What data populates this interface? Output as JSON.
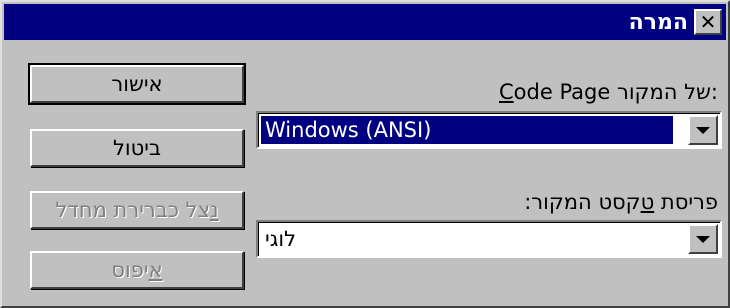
{
  "dialog": {
    "title": "המרה",
    "close_symbol": "✕"
  },
  "buttons": {
    "ok": "אישור",
    "cancel": "ביטול",
    "show_preview_prefix": "",
    "show_preview_underline": "נ",
    "show_preview_rest": "צל כברירת מחדל",
    "reset_underline": "א",
    "reset_rest": "יפוס"
  },
  "code_page": {
    "label_prefix": "",
    "label_underline": "C",
    "label_rest": "ode Page של המקור:",
    "value": "Windows (ANSI)"
  },
  "text_layout": {
    "label_before": "פריסת ",
    "label_underline": "ט",
    "label_rest": "קסט המקור:",
    "value": "לוגי"
  },
  "icons": {
    "close": "close-icon",
    "dropdown": "chevron-down-icon"
  }
}
